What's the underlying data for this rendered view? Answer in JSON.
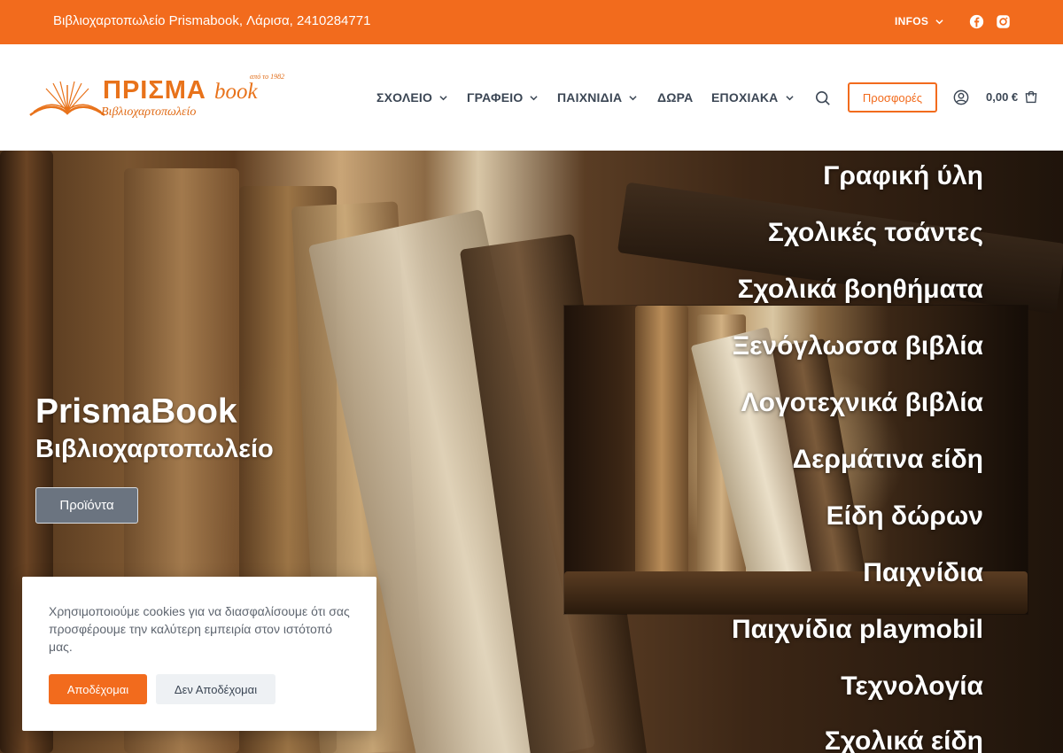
{
  "topbar": {
    "contact": "Βιβλιοχαρτοπωλείο Prismabook, Λάρισα, 2410284771",
    "infos_label": "INFOS",
    "icons": [
      "chevron-down-icon",
      "facebook-icon",
      "instagram-icon"
    ]
  },
  "logo": {
    "since": "από το 1982",
    "brand": "ΠΡΙΣΜΑ",
    "brand_suffix": "book",
    "tagline": "Βιβλιοχαρτοπωλείο"
  },
  "nav": {
    "items": [
      {
        "label": "ΣΧΟΛΕΙΟ",
        "has_dropdown": true
      },
      {
        "label": "ΓΡΑΦΕΙΟ",
        "has_dropdown": true
      },
      {
        "label": "ΠΑΙΧΝΙΔΙΑ",
        "has_dropdown": true
      },
      {
        "label": "ΔΩΡΑ",
        "has_dropdown": false
      },
      {
        "label": "ΕΠΟΧΙΑΚΑ",
        "has_dropdown": true
      }
    ],
    "offers_label": "Προσφορές",
    "cart_total": "0,00 €"
  },
  "hero": {
    "title": "PrismaBook",
    "subtitle": "Βιβλιοχαρτοπωλείο",
    "button_label": "Προϊόντα",
    "categories": [
      "Γραφική ύλη",
      "Σχολικές τσάντες",
      "Σχολικά βοηθήματα",
      "Ξενόγλωσσα βιβλία",
      "Λογοτεχνικά βιβλία",
      "Δερμάτινα είδη",
      "Είδη δώρων",
      "Παιχνίδια",
      "Παιχνίδια playmobil",
      "Τεχνολογία",
      "Σχολικά είδη"
    ]
  },
  "cookie": {
    "message": "Χρησιμοποιούμε cookies για να διασφαλίσουμε ότι σας προσφέρουμε την καλύτερη εμπειρία στον ιστότοπό μας.",
    "accept_label": "Αποδέχομαι",
    "decline_label": "Δεν Αποδέχομαι"
  },
  "colors": {
    "brand_orange": "#f26b1d",
    "nav_text": "#3b4654",
    "hero_button": "#6b7480"
  }
}
